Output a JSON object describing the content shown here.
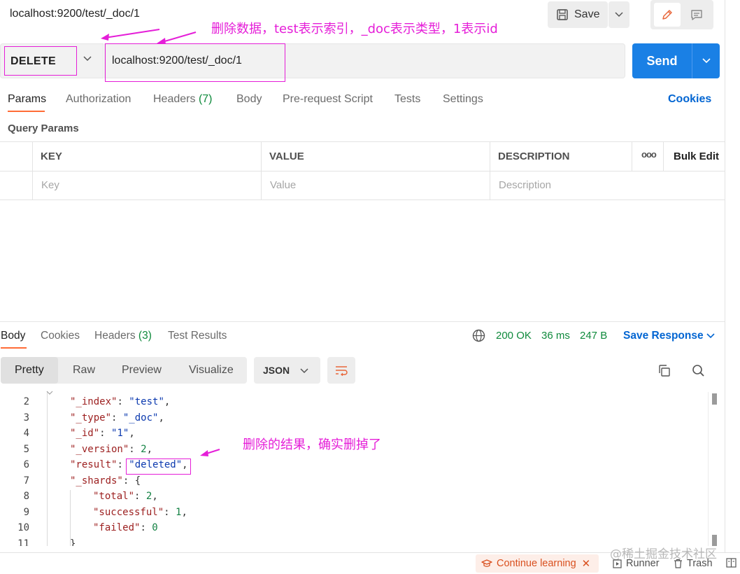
{
  "header": {
    "title": "localhost:9200/test/_doc/1",
    "save_label": "Save"
  },
  "annotations": {
    "top": "删除数据，test表示索引，_doc表示类型，1表示id",
    "result": "删除的结果，确实删掉了"
  },
  "request": {
    "method": "DELETE",
    "url": "localhost:9200/test/_doc/1",
    "send_label": "Send"
  },
  "request_tabs": [
    {
      "label": "Params",
      "active": true
    },
    {
      "label": "Authorization"
    },
    {
      "label": "Headers",
      "count": "(7)"
    },
    {
      "label": "Body"
    },
    {
      "label": "Pre-request Script"
    },
    {
      "label": "Tests"
    },
    {
      "label": "Settings"
    }
  ],
  "cookies_label": "Cookies",
  "query_params": {
    "title": "Query Params",
    "columns": [
      "KEY",
      "VALUE",
      "DESCRIPTION"
    ],
    "more": "ooo",
    "bulk_edit": "Bulk Edit",
    "placeholders": [
      "Key",
      "Value",
      "Description"
    ]
  },
  "response": {
    "tabs": [
      {
        "label": "Body",
        "active": true
      },
      {
        "label": "Cookies"
      },
      {
        "label": "Headers",
        "count": "(3)"
      },
      {
        "label": "Test Results"
      }
    ],
    "status": "200 OK",
    "time": "36 ms",
    "size": "247 B",
    "save_label": "Save Response",
    "formats": [
      "Pretty",
      "Raw",
      "Preview",
      "Visualize"
    ],
    "active_format": "Pretty",
    "language": "JSON"
  },
  "code_lines": [
    {
      "n": "2",
      "indent": 0,
      "key": "\"_index\"",
      "val": "\"test\"",
      "val_type": "s",
      "tail": ","
    },
    {
      "n": "3",
      "indent": 0,
      "key": "\"_type\"",
      "val": "\"_doc\"",
      "val_type": "s",
      "tail": ","
    },
    {
      "n": "4",
      "indent": 0,
      "key": "\"_id\"",
      "val": "\"1\"",
      "val_type": "s",
      "tail": ","
    },
    {
      "n": "5",
      "indent": 0,
      "key": "\"_version\"",
      "val": "2",
      "val_type": "n",
      "tail": ","
    },
    {
      "n": "6",
      "indent": 0,
      "key": "\"result\"",
      "val": "\"deleted\"",
      "val_type": "s",
      "tail": ","
    },
    {
      "n": "7",
      "indent": 0,
      "key": "\"_shards\"",
      "val": "{",
      "val_type": "p",
      "tail": ""
    },
    {
      "n": "8",
      "indent": 1,
      "key": "\"total\"",
      "val": "2",
      "val_type": "n",
      "tail": ","
    },
    {
      "n": "9",
      "indent": 1,
      "key": "\"successful\"",
      "val": "1",
      "val_type": "n",
      "tail": ","
    },
    {
      "n": "10",
      "indent": 1,
      "key": "\"failed\"",
      "val": "0",
      "val_type": "n",
      "tail": ""
    },
    {
      "n": "11",
      "indent": 0,
      "key": "",
      "val": "}",
      "val_type": "p",
      "tail": ""
    }
  ],
  "statusbar": {
    "continue_learning": "Continue learning",
    "runner": "Runner",
    "trash": "Trash"
  },
  "watermark": "@稀土掘金技术社区",
  "colors": {
    "accent_orange": "#ff6c37",
    "send_blue": "#1a80e5",
    "annotation_magenta": "#e51ed8",
    "status_green": "#0f8a3c"
  }
}
